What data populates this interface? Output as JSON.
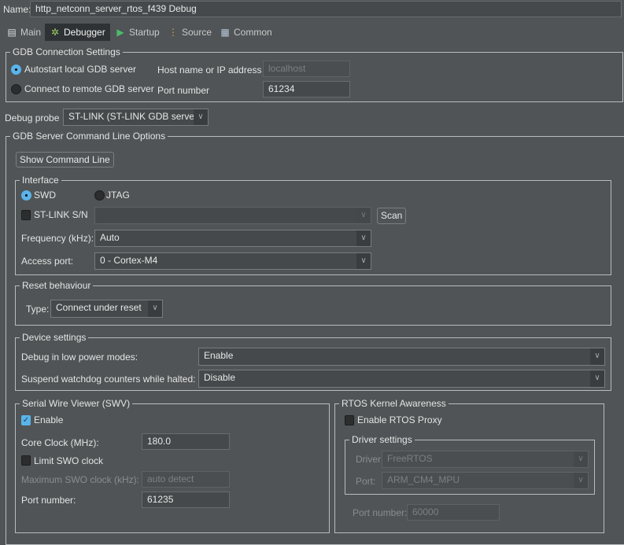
{
  "name_label": "Name:",
  "name_value": "http_netconn_server_rtos_f439 Debug",
  "tabs": [
    {
      "label": "Main",
      "icon": "document-icon"
    },
    {
      "label": "Debugger",
      "icon": "bug-icon"
    },
    {
      "label": "Startup",
      "icon": "play-icon"
    },
    {
      "label": "Source",
      "icon": "source-tree-icon"
    },
    {
      "label": "Common",
      "icon": "table-icon"
    }
  ],
  "gdb_conn": {
    "title": "GDB Connection Settings",
    "autostart": "Autostart local GDB server",
    "remote": "Connect to remote GDB server",
    "host_label": "Host name or IP address",
    "host_value": "localhost",
    "port_label": "Port number",
    "port_value": "61234"
  },
  "probe": {
    "label": "Debug probe",
    "value": "ST-LINK (ST-LINK GDB server)"
  },
  "server": {
    "title": "GDB Server Command Line Options",
    "show_cmd": "Show Command Line",
    "interface": {
      "title": "Interface",
      "swd": "SWD",
      "jtag": "JTAG",
      "sn_label": "ST-LINK S/N",
      "sn_value": "",
      "scan": "Scan",
      "freq_label": "Frequency (kHz):",
      "freq_value": "Auto",
      "ap_label": "Access port:",
      "ap_value": "0 - Cortex-M4"
    },
    "reset": {
      "title": "Reset behaviour",
      "type_label": "Type:",
      "type_value": "Connect under reset"
    },
    "device": {
      "title": "Device settings",
      "lowpower_label": "Debug in low power modes:",
      "lowpower_value": "Enable",
      "watchdog_label": "Suspend watchdog counters while halted:",
      "watchdog_value": "Disable"
    },
    "swv": {
      "title": "Serial Wire Viewer (SWV)",
      "enable": "Enable",
      "core_label": "Core Clock (MHz):",
      "core_value": "180.0",
      "limit": "Limit SWO clock",
      "max_label": "Maximum SWO clock (kHz):",
      "max_placeholder": "auto detect",
      "port_label": "Port number:",
      "port_value": "61235"
    },
    "rtos": {
      "title": "RTOS Kernel Awareness",
      "enable": "Enable RTOS Proxy",
      "driver_title": "Driver settings",
      "driver_label": "Driver:",
      "driver_value": "FreeRTOS",
      "port_label": "Port:",
      "port_value": "ARM_CM4_MPU",
      "portnum_label": "Port number:",
      "portnum_value": "60000"
    }
  },
  "colors": {
    "accent": "#5ab4ea",
    "background": "#505456"
  }
}
